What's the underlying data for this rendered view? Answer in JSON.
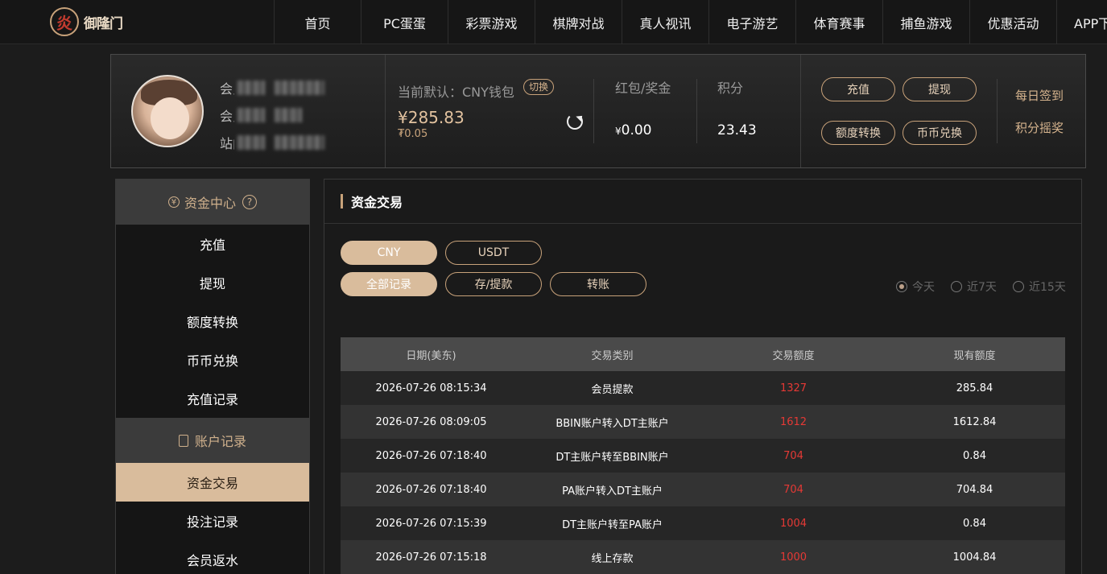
{
  "nav": {
    "logo_text": "御隆门",
    "items": [
      "首页",
      "PC蛋蛋",
      "彩票游戏",
      "棋牌对战",
      "真人视讯",
      "电子游艺",
      "体育赛事",
      "捕鱼游戏",
      "优惠活动",
      "APP下"
    ]
  },
  "account": {
    "labels": [
      "会员",
      "会员",
      "站内"
    ],
    "wallet_label": "当前默认：CNY钱包",
    "switch_label": "切换",
    "balance": "¥285.83",
    "sub_balance": "₮0.05",
    "bonus_label": "红包/奖金",
    "bonus_currency": "¥",
    "bonus_value": "0.00",
    "points_label": "积分",
    "points_value": "23.43",
    "buttons": {
      "deposit": "充值",
      "withdraw": "提现",
      "transfer": "额度转换",
      "exchange": "币币兑换"
    },
    "links": {
      "checkin": "每日签到",
      "lottery": "积分摇奖"
    }
  },
  "sidebar": {
    "fund_center": "资金中心",
    "fund_items": [
      "充值",
      "提现",
      "额度转换",
      "币币兑换",
      "充值记录"
    ],
    "records_title": "账户记录",
    "record_items": [
      "资金交易",
      "投注记录",
      "会员返水"
    ]
  },
  "content": {
    "title": "资金交易",
    "currency_tabs": [
      "CNY",
      "USDT"
    ],
    "type_tabs": [
      "全部记录",
      "存/提款",
      "转账"
    ],
    "ranges": [
      "今天",
      "近7天",
      "近15天"
    ],
    "table": {
      "headers": [
        "日期(美东)",
        "交易类别",
        "交易额度",
        "现有额度"
      ],
      "rows": [
        [
          "2026-07-26 08:15:34",
          "会员提款",
          "1327",
          "285.84"
        ],
        [
          "2026-07-26 08:09:05",
          "BBIN账户转入DT主账户",
          "1612",
          "1612.84"
        ],
        [
          "2026-07-26 07:18:40",
          "DT主账户转至BBIN账户",
          "704",
          "0.84"
        ],
        [
          "2026-07-26 07:18:40",
          "PA账户转入DT主账户",
          "704",
          "704.84"
        ],
        [
          "2026-07-26 07:15:39",
          "DT主账户转至PA账户",
          "1004",
          "0.84"
        ],
        [
          "2026-07-26 07:15:18",
          "线上存款",
          "1000",
          "1004.84"
        ]
      ]
    }
  }
}
